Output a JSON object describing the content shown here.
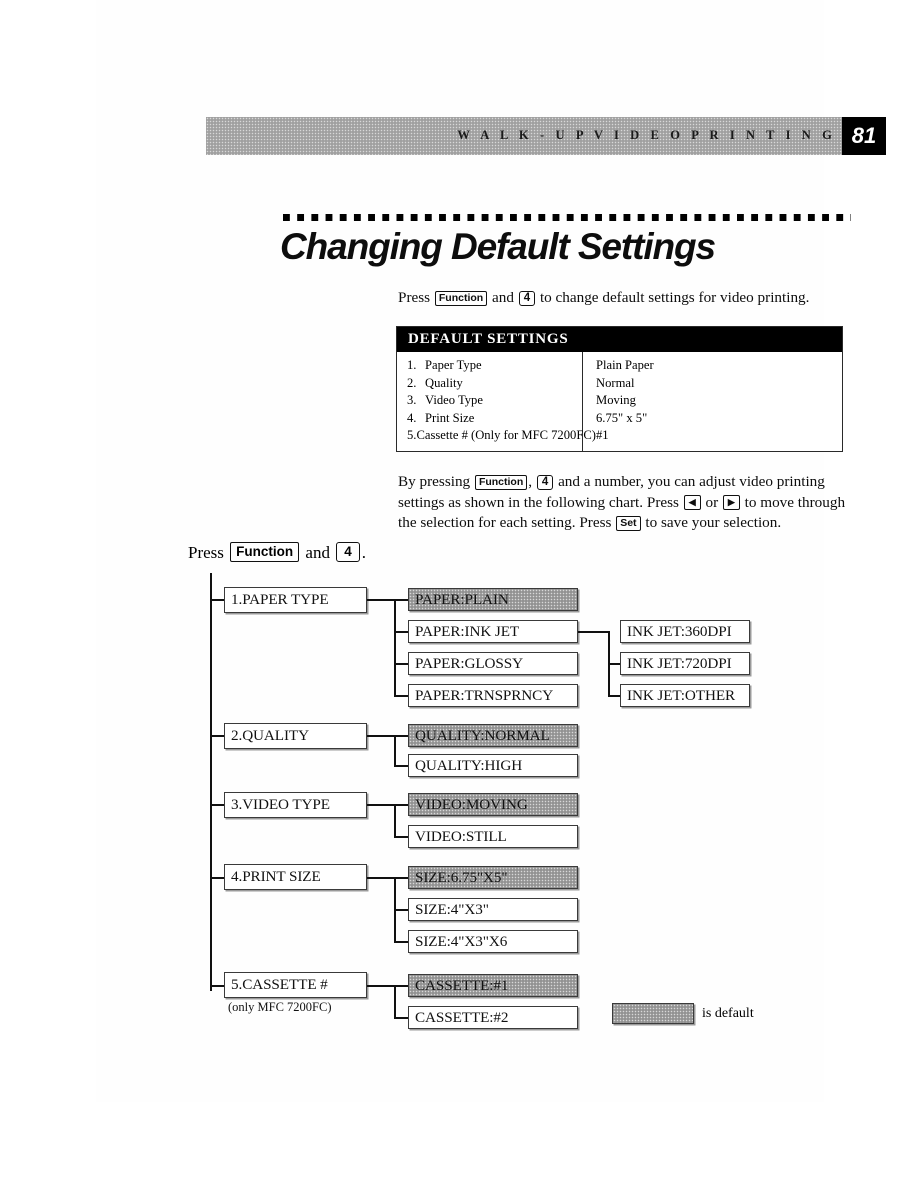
{
  "header": {
    "title": "W A L K - U P   V I D E O   P R I N T I N G",
    "page_number": "81",
    "bar_color": "#a8a8a8",
    "number_box_color": "#000000"
  },
  "section": {
    "title": "Changing Default Settings"
  },
  "intro": {
    "before_function": "Press",
    "key_function": "Function",
    "between": "and",
    "key_number": "4",
    "after": "to change default settings for video printing."
  },
  "settings_table": {
    "heading": "DEFAULT SETTINGS",
    "rows": [
      {
        "index": "1.",
        "name": "Paper Type",
        "value": "Plain Paper"
      },
      {
        "index": "2.",
        "name": "Quality",
        "value": "Normal"
      },
      {
        "index": "3.",
        "name": "Video Type",
        "value": "Moving"
      },
      {
        "index": "4.",
        "name": "Print Size",
        "value": "6.75\" x 5\""
      },
      {
        "index": "5.",
        "name": "Cassette # (Only for MFC 7200FC)",
        "value": "#1"
      }
    ]
  },
  "body": {
    "t1": "By  pressing",
    "k1": "Function",
    "t2": ",",
    "k2": "4",
    "t3": "and a number, you can adjust video printing settings as shown in the following chart. Press",
    "k3": "◀",
    "t4": "or",
    "k4": "▶",
    "t5": "to move through the selection for each setting. Press",
    "k5": "Set",
    "t6": "to save your selection."
  },
  "chart_press": {
    "press": "Press",
    "key_function": "Function",
    "and": "and",
    "key_number": "4",
    "period": "."
  },
  "flow": {
    "menus": [
      {
        "label": "1.PAPER TYPE",
        "options": [
          {
            "label": "PAPER:PLAIN",
            "default": true
          },
          {
            "label": "PAPER:INK JET",
            "default": false
          },
          {
            "label": "PAPER:GLOSSY",
            "default": false
          },
          {
            "label": "PAPER:TRNSPRNCY",
            "default": false
          }
        ]
      },
      {
        "label": "2.QUALITY",
        "options": [
          {
            "label": "QUALITY:NORMAL",
            "default": true
          },
          {
            "label": "QUALITY:HIGH",
            "default": false
          }
        ]
      },
      {
        "label": "3.VIDEO TYPE",
        "options": [
          {
            "label": "VIDEO:MOVING",
            "default": true
          },
          {
            "label": "VIDEO:STILL",
            "default": false
          }
        ]
      },
      {
        "label": "4.PRINT SIZE",
        "options": [
          {
            "label": "SIZE:6.75\"X5\"",
            "default": true
          },
          {
            "label": "SIZE:4\"X3\"",
            "default": false
          },
          {
            "label": "SIZE:4\"X3\"X6",
            "default": false
          }
        ]
      },
      {
        "label": "5.CASSETTE #",
        "sublabel": "(only MFC 7200FC)",
        "options": [
          {
            "label": "CASSETTE:#1",
            "default": true
          },
          {
            "label": "CASSETTE:#2",
            "default": false
          }
        ]
      }
    ],
    "submenu_inkjet": [
      {
        "label": "INK JET:360DPI",
        "default": false
      },
      {
        "label": "INK JET:720DPI",
        "default": false
      },
      {
        "label": "INK JET:OTHER",
        "default": false
      }
    ]
  },
  "legend": {
    "text": "is default",
    "swatch_color": "#9d9d9d"
  }
}
